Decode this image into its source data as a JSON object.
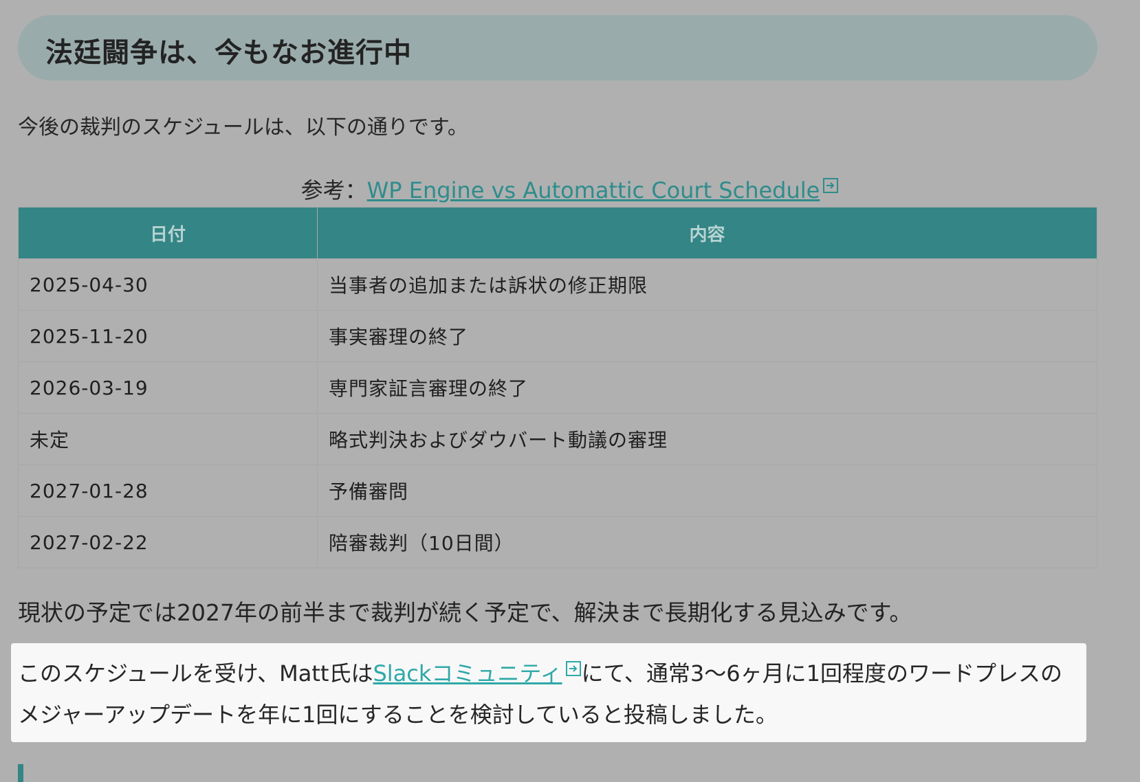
{
  "section": {
    "heading": "法廷闘争は、今もなお進行中",
    "intro": "今後の裁判のスケジュールは、以下の通りです。",
    "reference_prefix": "参考：",
    "reference_link": "WP Engine vs Automattic Court Schedule"
  },
  "table": {
    "headers": [
      "日付",
      "内容"
    ],
    "rows": [
      {
        "date": "2025-04-30",
        "content": "当事者の追加または訴状の修正期限"
      },
      {
        "date": "2025-11-20",
        "content": "事実審理の終了"
      },
      {
        "date": "2026-03-19",
        "content": "専門家証言審理の終了"
      },
      {
        "date": "未定",
        "content": "略式判決およびダウバート動議の審理"
      },
      {
        "date": "2027-01-28",
        "content": "予備審問"
      },
      {
        "date": "2027-02-22",
        "content": "陪審裁判（10日間）"
      }
    ]
  },
  "summary": "現状の予定では2027年の前半まで裁判が続く予定で、解決まで長期化する見込みです。",
  "note": {
    "before": "このスケジュールを受け、Matt氏は",
    "link": "Slackコミュニティ",
    "after": "にて、通常3〜6ヶ月に1回程度のワードプレスのメジャーアップデートを年に1回にすることを検討していると投稿しました。"
  },
  "icons": {
    "external_link": "external-link-icon"
  },
  "colors": {
    "accent": "#348585",
    "link": "#2f8c8c",
    "heading_bg": "#9aabab"
  }
}
